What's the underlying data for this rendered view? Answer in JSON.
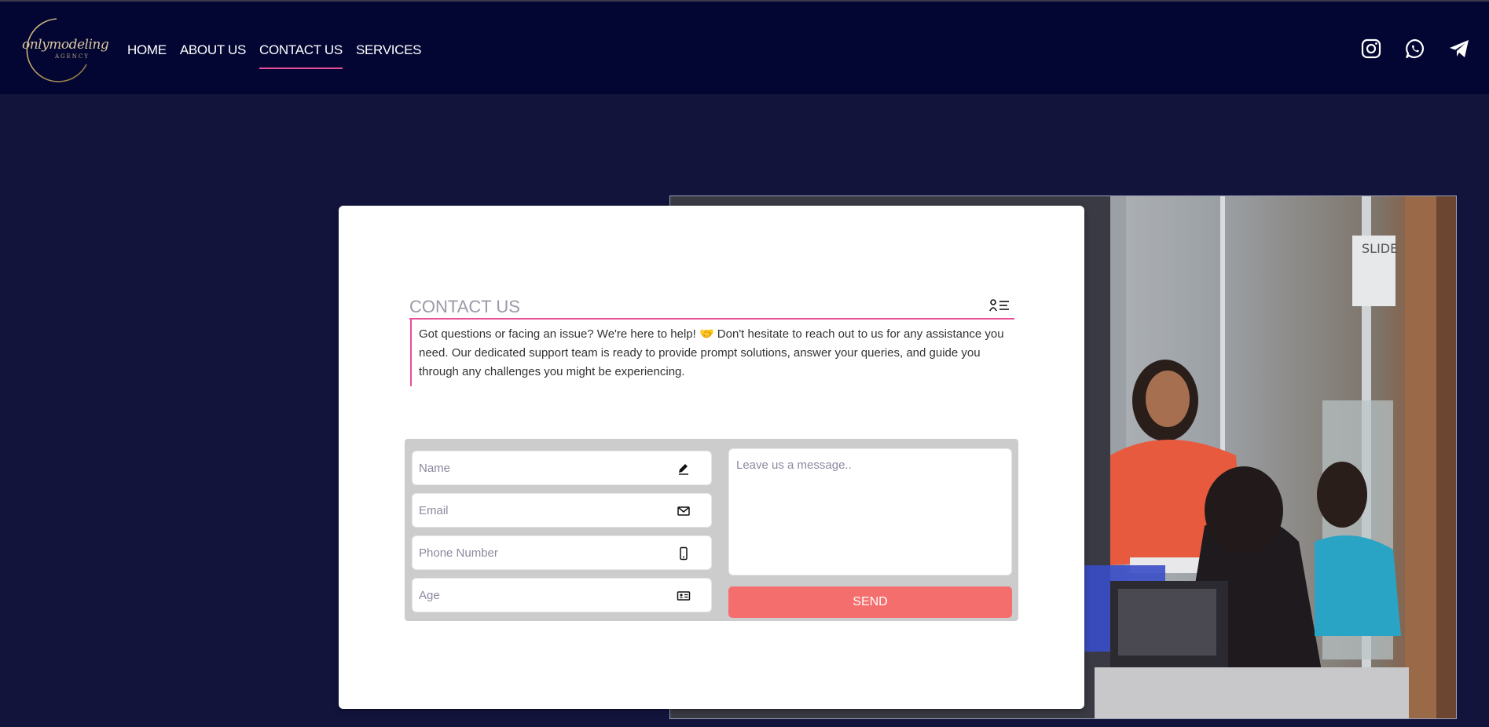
{
  "brand": {
    "logo_script": "onlymodeling",
    "logo_sub": "AGENCY"
  },
  "nav": {
    "items": [
      {
        "label": "HOME",
        "active": false
      },
      {
        "label": "ABOUT US",
        "active": false
      },
      {
        "label": "CONTACT US",
        "active": true
      },
      {
        "label": "SERVICES",
        "active": false
      }
    ]
  },
  "social": [
    "instagram-icon",
    "whatsapp-icon",
    "telegram-icon"
  ],
  "contact": {
    "title": "CONTACT US",
    "description": "Got questions or facing an issue? We're here to help! 🤝 Don't hesitate to reach out to us for any assistance you need. Our dedicated support team is ready to provide prompt solutions, answer your queries, and guide you through any challenges you might be experiencing."
  },
  "form": {
    "name_placeholder": "Name",
    "email_placeholder": "Email",
    "phone_placeholder": "Phone Number",
    "age_placeholder": "Age",
    "message_placeholder": "Leave us a message..",
    "send_label": "SEND"
  },
  "colors": {
    "header_bg": "#030632",
    "page_bg": "#13143c",
    "accent_pink": "#e8509a",
    "send_button": "#f56e6e"
  }
}
